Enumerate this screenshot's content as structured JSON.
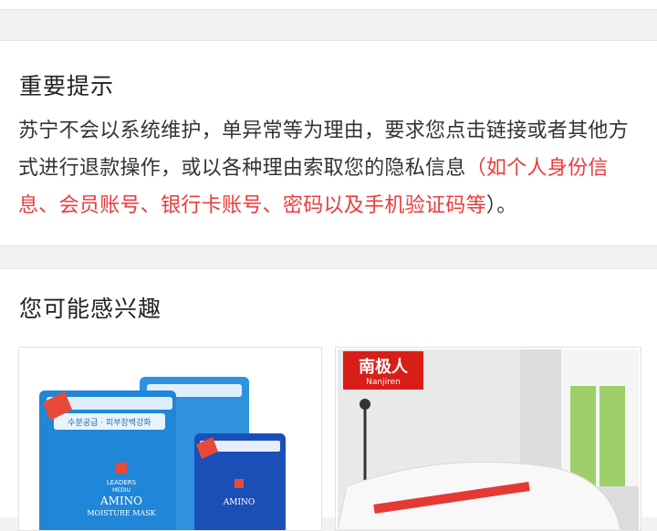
{
  "notice": {
    "title": "重要提示",
    "text_line1": "苏宁不会以系统维护，单异常等为理由，要求您点击链接或者其他方",
    "text_line2_plain": "式进行退款操作，或以各种理由索取您的隐私信息",
    "text_line2_red": "（如个人身份信",
    "text_line3_red": "息、会员账号、银行卡账号、密码以及手机验证码等",
    "text_line3_end": "）。",
    "highlight_color": "#ec3b3b"
  },
  "interest": {
    "title": "您可能感兴趣",
    "products": [
      {
        "brand_label": "LEADERS",
        "brand_sub": "MEDIU",
        "product_label": "AMINO",
        "product_sub": "MOISTURE MASK",
        "badge_text": "수분공급 · 피부장벽강화",
        "product_label_2": "AMINO"
      },
      {
        "brand_logo_cn": "南极人",
        "brand_logo_en": "Nanjiren"
      }
    ]
  }
}
